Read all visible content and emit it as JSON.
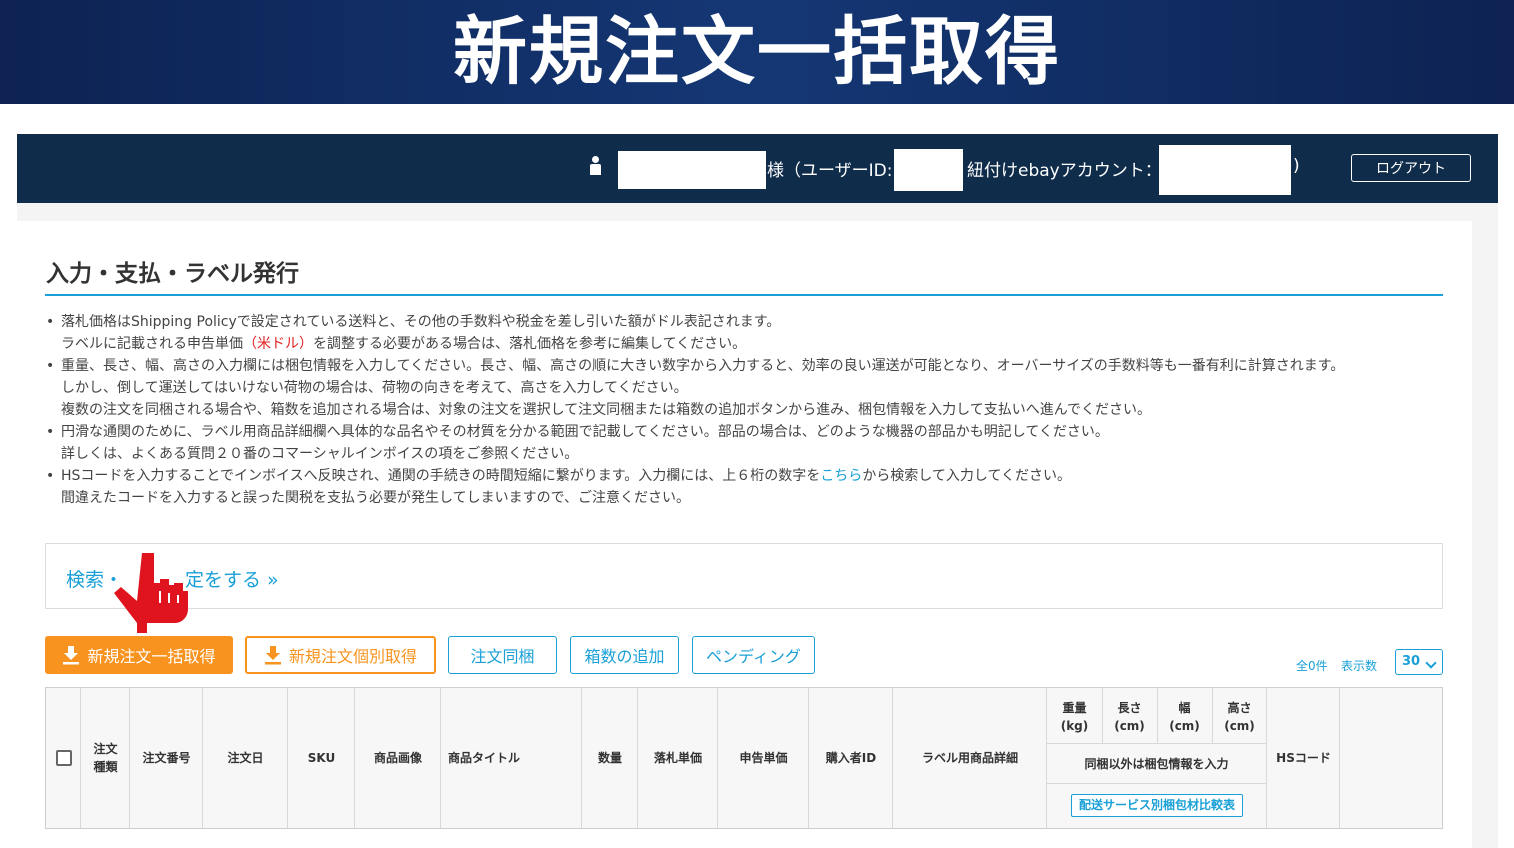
{
  "banner": {
    "title": "新規注文一括取得"
  },
  "topbar": {
    "honorific": "様（ユーザーID:",
    "linked_label": "紐付けebayアカウント：",
    "close_paren": ")",
    "logout_label": "ログアウト"
  },
  "section": {
    "title": "入力・支払・ラベル発行",
    "notes": [
      {
        "bullet": "•",
        "line1": "落札価格はShipping Policyで設定されている送料と、その他の手数料や税金を差し引いた額がドル表記されます。",
        "line2_a": "ラベルに記載される申告単価",
        "line2_red": "（米ドル）",
        "line2_b": "を調整する必要がある場合は、落札価格を参考に編集してください。"
      },
      {
        "bullet": "•",
        "line1": "重量、長さ、幅、高さの入力欄には梱包情報を入力してください。長さ、幅、高さの順に大きい数字から入力すると、効率の良い運送が可能となり、オーバーサイズの手数料等も一番有利に計算されます。",
        "line2": "しかし、倒して運送してはいけない荷物の場合は、荷物の向きを考えて、高さを入力してください。",
        "line3": "複数の注文を同梱される場合や、箱数を追加される場合は、対象の注文を選択して注文同梱または箱数の追加ボタンから進み、梱包情報を入力して支払いへ進んでください。"
      },
      {
        "bullet": "•",
        "line1": "円滑な通関のために、ラベル用商品詳細欄へ具体的な品名やその材質を分かる範囲で記載してください。部品の場合は、どのような機器の部品かも明記してください。",
        "line2": "詳しくは、よくある質問２０番のコマーシャルインボイスの項をご参照ください。"
      },
      {
        "bullet": "•",
        "line1_a": "HSコードを入力することでインボイスへ反映され、通関の手続きの時間短縮に繋がります。入力欄には、上６桁の数字を",
        "line1_link": "こちら",
        "line1_b": "から検索して入力してください。",
        "line2": "間違えたコードを入力すると誤った関税を支払う必要が発生してしまいますので、ご注意ください。"
      }
    ]
  },
  "search": {
    "link_a": "検索・",
    "link_b": "定をする »"
  },
  "buttons": {
    "bulk_fetch": "新規注文一括取得",
    "single_fetch": "新規注文個別取得",
    "merge": "注文同梱",
    "add_box": "箱数の追加",
    "pending": "ペンディング"
  },
  "pager": {
    "total": "全0件",
    "per_page_label": "表示数",
    "per_page_value": "30"
  },
  "table": {
    "order_type_1": "注文",
    "order_type_2": "種類",
    "order_no": "注文番号",
    "order_date": "注文日",
    "sku": "SKU",
    "image": "商品画像",
    "title": "商品タイトル",
    "qty": "数量",
    "bid_price": "落札単価",
    "declared_price": "申告単価",
    "buyer_id": "購入者ID",
    "label_detail": "ラベル用商品詳細",
    "weight_1": "重量",
    "weight_2": "(kg)",
    "length_1": "長さ",
    "length_2": "(cm)",
    "width_1": "幅",
    "width_2": "(cm)",
    "height_1": "高さ",
    "height_2": "(cm)",
    "package_note": "同梱以外は梱包情報を入力",
    "compare_button": "配送サービス別梱包材比較表",
    "hs_code": "HSコード"
  },
  "colors": {
    "accent": "#1aa0d6",
    "orange": "#f7931e",
    "topbar": "#0f2c4a",
    "banner": "#143774",
    "pointer": "#e0141e"
  },
  "icons": {
    "user": "user-icon",
    "download": "download-icon",
    "chevron": "chevron-down-icon",
    "pointer": "hand-pointer-icon"
  }
}
